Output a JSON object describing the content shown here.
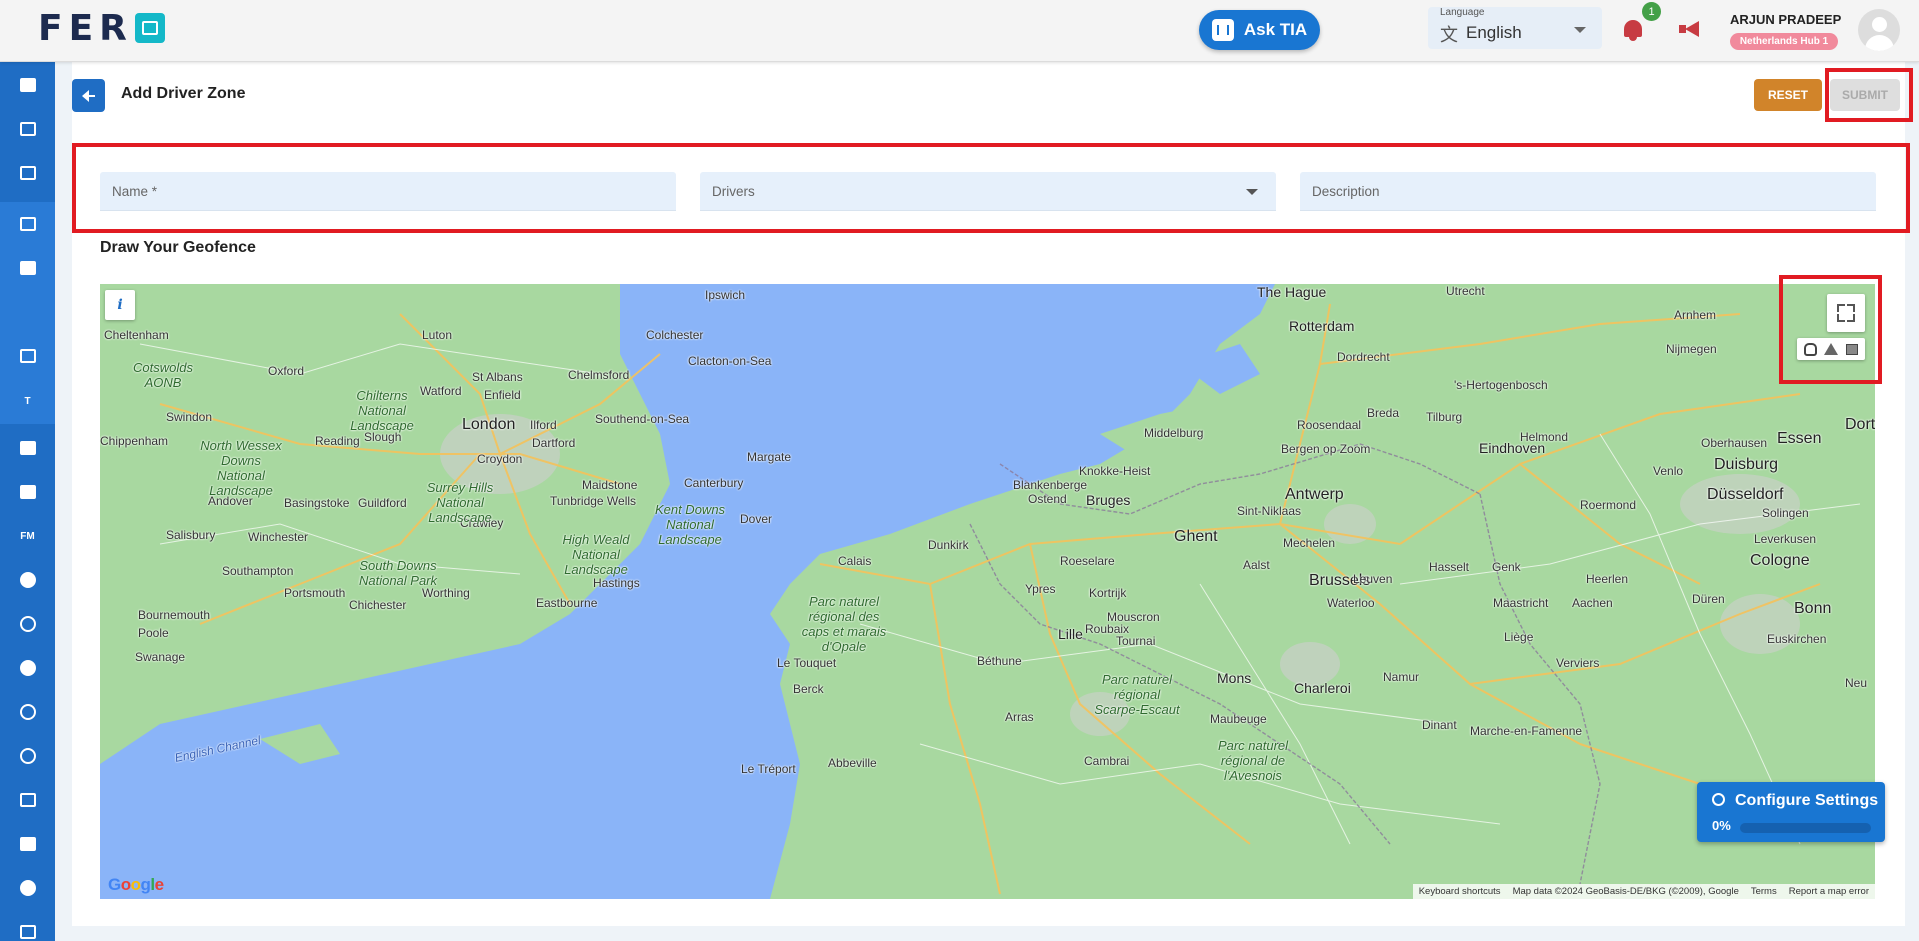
{
  "brand": {
    "logo_text": "FER"
  },
  "header": {
    "ask_tia_label": "Ask TIA",
    "language": {
      "label": "Language",
      "value": "English"
    },
    "notification_count": "1",
    "user": {
      "name": "ARJUN PRADEEP",
      "hub": "Netherlands Hub 1"
    }
  },
  "sidebar": {
    "items": [
      {
        "icon": "dashboard-icon"
      },
      {
        "icon": "analytics-icon"
      },
      {
        "icon": "calendar-check-icon"
      },
      {
        "icon": "clipboard-icon"
      },
      {
        "icon": "delivery-truck-icon"
      },
      {
        "icon": "driver-zone-icon",
        "active": true
      },
      {
        "icon": "grid-hash-icon"
      },
      {
        "icon": "text-icon",
        "label": "T"
      },
      {
        "icon": "truck-icon"
      },
      {
        "icon": "archive-icon"
      },
      {
        "icon": "fm-icon",
        "label": "FM"
      },
      {
        "icon": "users-icon"
      },
      {
        "icon": "info-icon"
      },
      {
        "icon": "group-icon"
      },
      {
        "icon": "support-icon"
      },
      {
        "icon": "settings-icon"
      },
      {
        "icon": "edit-note-icon"
      },
      {
        "icon": "documents-icon"
      },
      {
        "icon": "admin-user-icon"
      },
      {
        "icon": "download-icon"
      }
    ]
  },
  "page": {
    "title": "Add Driver Zone",
    "reset_label": "RESET",
    "submit_label": "SUBMIT"
  },
  "form": {
    "name_placeholder": "Name *",
    "drivers_placeholder": "Drivers",
    "description_placeholder": "Description"
  },
  "geofence": {
    "title": "Draw Your Geofence",
    "info_label": "i",
    "google_label": "Google",
    "attribution": {
      "shortcuts": "Keyboard shortcuts",
      "map_data": "Map data ©2024 GeoBasis-DE/BKG (©2009), Google",
      "terms": "Terms",
      "report": "Report a map error"
    },
    "places": {
      "the_hague": "The Hague",
      "rotterdam": "Rotterdam",
      "utrecht": "Utrecht",
      "arnhem": "Arnhem",
      "nijmegen": "Nijmegen",
      "dordrecht": "Dordrecht",
      "hertogenbosch": "'s-Hertogenbosch",
      "breda": "Breda",
      "tilburg": "Tilburg",
      "eindhoven": "Eindhoven",
      "roosendaal": "Roosendaal",
      "middelburg": "Middelburg",
      "helmond": "Helmond",
      "oberhausen": "Oberhausen",
      "essen": "Essen",
      "dortmund": "Dortr",
      "duisburg": "Duisburg",
      "dusseldorf": "Düsseldorf",
      "solingen": "Solingen",
      "leverkusen": "Leverkusen",
      "cologne": "Cologne",
      "bonn": "Bonn",
      "duren": "Düren",
      "aachen": "Aachen",
      "heerlen": "Heerlen",
      "maastricht": "Maastricht",
      "hasselt": "Hasselt",
      "genk": "Genk",
      "roermond": "Roermond",
      "venlo": "Venlo",
      "antwerp": "Antwerp",
      "ghent": "Ghent",
      "brussels": "Brussels",
      "bruges": "Bruges",
      "ostend": "Ostend",
      "blankenberge": "Blankenberge",
      "knokke": "Knokke-Heist",
      "bergen": "Bergen op Zoom",
      "sint_niklaas": "Sint-Niklaas",
      "mechelen": "Mechelen",
      "leuven": "Leuven",
      "aalst": "Aalst",
      "roeselare": "Roeselare",
      "kortrijk": "Kortrijk",
      "ypres": "Ypres",
      "lille": "Lille",
      "roubaix": "Roubaix",
      "mouscron": "Mouscron",
      "tournai": "Tournai",
      "waterloo": "Waterloo",
      "mons": "Mons",
      "charleroi": "Charleroi",
      "namur": "Namur",
      "liege": "Liège",
      "verviers": "Verviers",
      "dinant": "Dinant",
      "maubeuge": "Maubeuge",
      "marche": "Marche-en-Famenne",
      "euskirchen": "Euskirchen",
      "dunkirk": "Dunkirk",
      "calais": "Calais",
      "bethune": "Béthune",
      "arras": "Arras",
      "cambrai": "Cambrai",
      "abbeville": "Abbeville",
      "berck": "Berck",
      "le_touquet": "Le Touquet",
      "le_treport": "Le Tréport",
      "ipswich": "Ipswich",
      "colchester": "Colchester",
      "clacton": "Clacton-on-Sea",
      "chelmsford": "Chelmsford",
      "southend": "Southend-on-Sea",
      "london": "London",
      "ilford": "Ilford",
      "dartford": "Dartford",
      "croydon": "Croydon",
      "maidstone": "Maidstone",
      "canterbury": "Canterbury",
      "margate": "Margate",
      "dover": "Dover",
      "crawley": "Crawley",
      "tunbridge": "Tunbridge Wells",
      "hastings": "Hastings",
      "eastbourne": "Eastbourne",
      "worthing": "Worthing",
      "chichester": "Chichester",
      "portsmouth": "Portsmouth",
      "southampton": "Southampton",
      "bournemouth": "Bournemouth",
      "poole": "Poole",
      "swanage": "Swanage",
      "salisbury": "Salisbury",
      "winchester": "Winchester",
      "andover": "Andover",
      "basingstoke": "Basingstoke",
      "guildford": "Guildford",
      "reading": "Reading",
      "slough": "Slough",
      "watford": "Watford",
      "luton": "Luton",
      "st_albans": "St Albans",
      "enfield": "Enfield",
      "oxford": "Oxford",
      "swindon": "Swindon",
      "cheltenham": "Cheltenham",
      "chippenham": "Chippenham",
      "coul": "Neu"
    },
    "parks": {
      "cotswolds": "Cotswolds AONB",
      "chilterns": "Chilterns National Landscape",
      "north_wessex": "North Wessex Downs National Landscape",
      "surrey_hills": "Surrey Hills National Landscape",
      "kent_downs": "Kent Downs National Landscape",
      "high_weald": "High Weald National Landscape",
      "south_downs": "South Downs National Park",
      "caps_marais": "Parc naturel régional des caps et marais d'Opale",
      "scarpe": "Parc naturel régional Scarpe-Escaut",
      "avesnois": "Parc naturel régional de l'Avesnois"
    },
    "water": {
      "english_channel": "English Channel"
    }
  },
  "configure": {
    "title": "Configure Settings",
    "percent_label": "0%",
    "progress": 0
  },
  "colors": {
    "sidebar": "#1f6dc4",
    "accent": "#1976d2",
    "reset": "#d1842a",
    "highlight": "#e11b22",
    "active": "#8bd52b"
  }
}
